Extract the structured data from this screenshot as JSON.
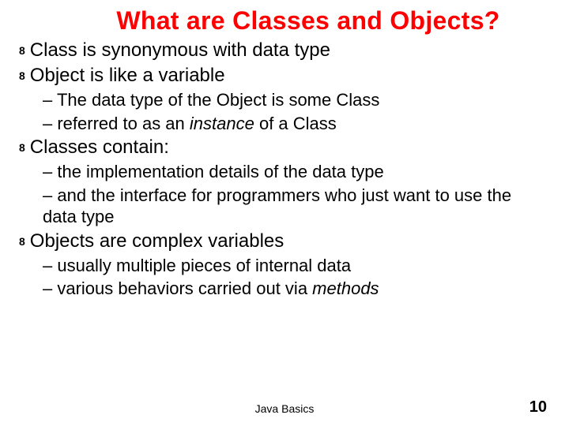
{
  "title": "What are Classes and Objects?",
  "bullets": {
    "b1": "Class is synonymous with data type",
    "b2": "Object is like a variable",
    "b2s1": "– The data type of the Object is some Class",
    "b2s2a": "– referred to as an ",
    "b2s2b": "instance",
    "b2s2c": " of a Class",
    "b3": "Classes contain:",
    "b3s1": "–  the implementation details of the data type",
    "b3s2": "– and the interface for programmers who just want to use the data type",
    "b4": "Objects are complex variables",
    "b4s1": "– usually multiple pieces of internal data",
    "b4s2a": "– various behaviors carried out via ",
    "b4s2b": "methods"
  },
  "footer": "Java Basics",
  "page": "10",
  "marker": "8"
}
